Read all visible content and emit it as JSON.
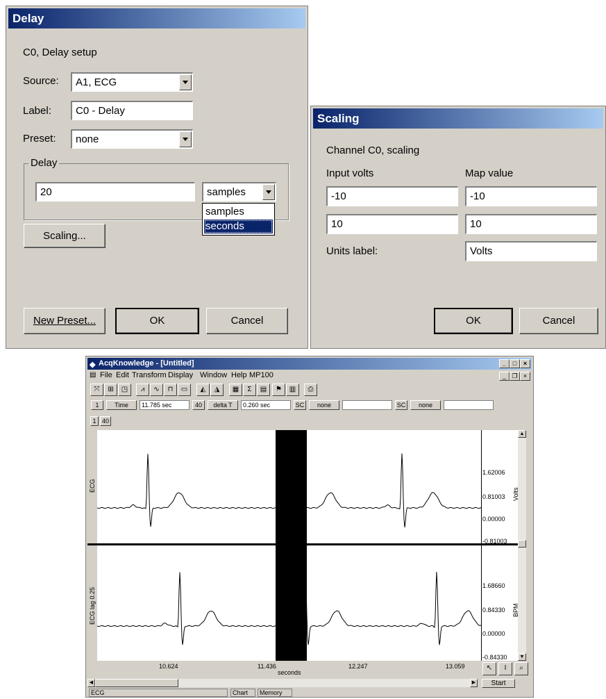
{
  "delay_dialog": {
    "title": "Delay",
    "subtitle": "C0, Delay setup",
    "source_label": "Source:",
    "source_value": "A1, ECG",
    "label_label": "Label:",
    "label_value": "C0 - Delay",
    "preset_label": "Preset:",
    "preset_value": "none",
    "group_title": "Delay",
    "delay_value": "20",
    "unit_value": "samples",
    "unit_options": [
      "samples",
      "seconds"
    ],
    "scaling_button": "Scaling...",
    "new_preset_button": "New Preset...",
    "ok_button": "OK",
    "cancel_button": "Cancel"
  },
  "scaling_dialog": {
    "title": "Scaling",
    "subtitle": "Channel C0, scaling",
    "input_header": "Input volts",
    "map_header": "Map value",
    "input1": "-10",
    "map1": "-10",
    "input2": "10",
    "map2": "10",
    "units_label": "Units label:",
    "units_value": "Volts",
    "ok_button": "OK",
    "cancel_button": "Cancel"
  },
  "acq_window": {
    "title": "AcqKnowledge - [Untitled]",
    "menus": [
      "File",
      "Edit",
      "Transform",
      "Display",
      "Window",
      "Help",
      "MP100"
    ],
    "measure": {
      "ch1": "1",
      "m1": "Time",
      "v1": "11.785 sec",
      "ch2": "40",
      "m2": "delta T",
      "v2": "0.260 sec",
      "ch3": "SC",
      "m3": "none",
      "v3": "",
      "ch4": "SC",
      "m4": "none",
      "v4": ""
    },
    "channel_buttons": [
      "1",
      "40"
    ],
    "top_channel": {
      "label": "ECG",
      "units": "Volts",
      "scale": [
        "1.62006",
        "0.81003",
        "0.00000",
        "-0.81003"
      ]
    },
    "bottom_channel": {
      "label": "ECG lag 0.25",
      "units": "BPM",
      "scale": [
        "1.68660",
        "0.84330",
        "0.00000",
        "-0.84330"
      ]
    },
    "x_ticks": [
      "10.624",
      "11.436",
      "12.247",
      "13.059"
    ],
    "x_label": "seconds",
    "start_button": "Start",
    "status": {
      "channel": "ECG",
      "mode": "Chart",
      "memory": "Memory"
    },
    "selection_color": "#000000"
  }
}
